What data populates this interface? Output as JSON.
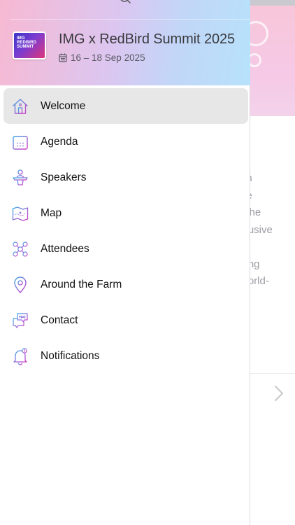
{
  "background_page": {
    "text_lines": [
      "on",
      "ne",
      "t the",
      "clusive",
      "t",
      "king",
      "world-"
    ]
  },
  "drawer": {
    "event": {
      "logo_text": [
        "IMG",
        "REDBIRD",
        "SUMMIT"
      ],
      "title": "IMG x RedBird Summit 2025",
      "dates": "16 – 18 Sep 2025"
    },
    "menu": [
      {
        "label": "Welcome",
        "icon": "home-icon",
        "active": true
      },
      {
        "label": "Agenda",
        "icon": "calendar-icon",
        "active": false
      },
      {
        "label": "Speakers",
        "icon": "speaker-podium-icon",
        "active": false
      },
      {
        "label": "Map",
        "icon": "map-icon",
        "active": false
      },
      {
        "label": "Attendees",
        "icon": "attendees-network-icon",
        "active": false
      },
      {
        "label": "Around the Farm",
        "icon": "location-pin-icon",
        "active": false
      },
      {
        "label": "Contact",
        "icon": "faq-chat-icon",
        "active": false
      },
      {
        "label": "Notifications",
        "icon": "bell-icon",
        "active": false
      }
    ]
  },
  "colors": {
    "gradient_pink": "#f7b9d2",
    "gradient_blue": "#b7e2fb",
    "icon_gradient_start": "#3aa8e8",
    "icon_gradient_end": "#d63ac9",
    "active_row": "#e7e7e8"
  }
}
